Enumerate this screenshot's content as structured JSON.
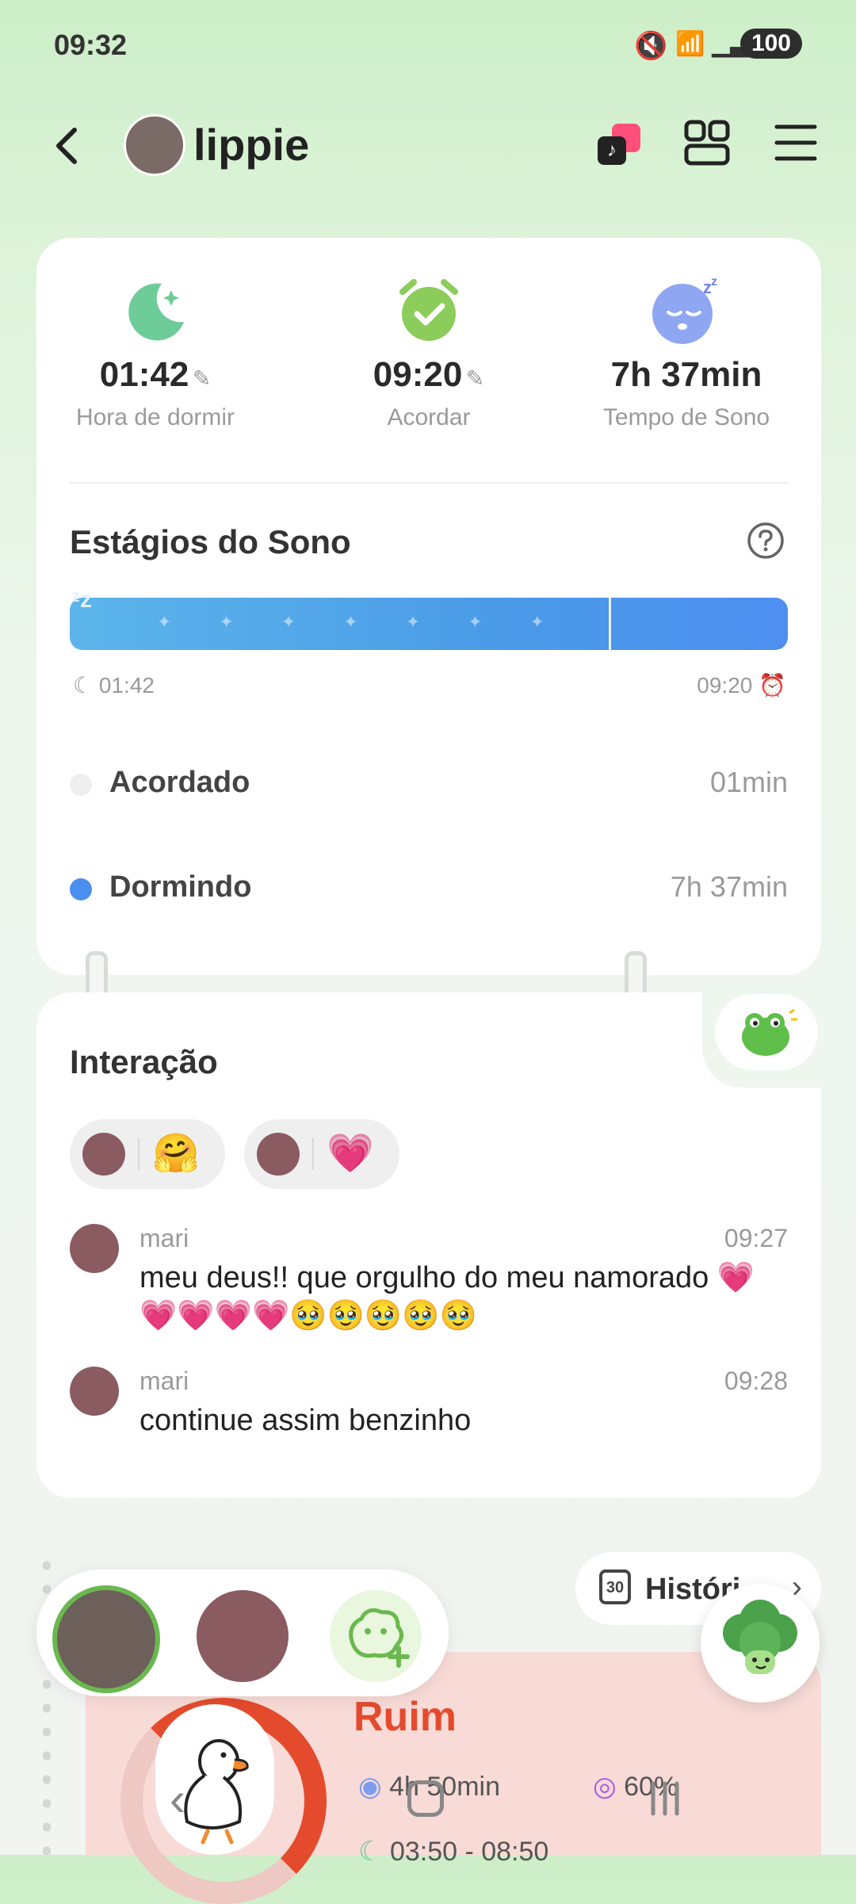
{
  "status_bar": {
    "time": "09:32",
    "battery": "100"
  },
  "header": {
    "username": "lippie"
  },
  "sleep_summary": {
    "bedtime": {
      "value": "01:42",
      "label": "Hora de dormir"
    },
    "wake": {
      "value": "09:20",
      "label": "Acordar"
    },
    "duration": {
      "value": "7h 37min",
      "label": "Tempo de Sono"
    }
  },
  "stages": {
    "title": "Estágios do Sono",
    "start": "01:42",
    "end": "09:20",
    "awake_fraction": 0.002,
    "rows": [
      {
        "label": "Acordado",
        "value": "01min",
        "color": "#eeeeee"
      },
      {
        "label": "Dormindo",
        "value": "7h 37min",
        "color": "#4a8ef0"
      }
    ]
  },
  "interaction": {
    "title": "Interação",
    "messages": [
      {
        "name": "mari",
        "time": "09:27",
        "text": "meu deus!! que orgulho do meu namorado 💗💗💗💗💗🥹🥹🥹🥹🥹"
      },
      {
        "name": "mari",
        "time": "09:28",
        "text": "continue assim benzinho"
      }
    ]
  },
  "history": {
    "label": "Históri"
  },
  "report": {
    "quality": "Ruim",
    "stat1": "4h 50min",
    "stat2": "60%",
    "range": "03:50 - 08:50"
  },
  "colors": {
    "accent": "#7dc97a",
    "bar": "#4a9be8",
    "bad": "#e44b2d"
  }
}
